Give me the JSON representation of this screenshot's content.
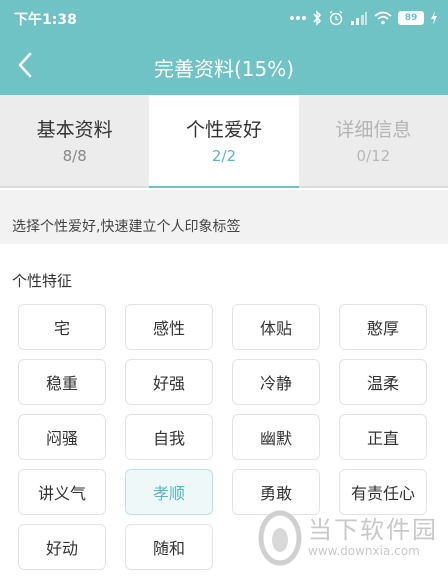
{
  "status_bar": {
    "time": "下午1:38",
    "battery": "89",
    "icons": [
      "dots-icon",
      "bluetooth-icon",
      "alarm-icon",
      "signal-icon",
      "wifi-icon",
      "battery-icon",
      "charging-icon"
    ]
  },
  "nav": {
    "title": "完善资料(15%)",
    "back_icon": "chevron-left-icon"
  },
  "tabs": [
    {
      "label": "基本资料",
      "count": "8/8",
      "state": "done"
    },
    {
      "label": "个性爱好",
      "count": "2/2",
      "state": "active"
    },
    {
      "label": "详细信息",
      "count": "0/12",
      "state": "disabled"
    }
  ],
  "hint": "选择个性爱好,快速建立个人印象标签",
  "section": {
    "title": "个性特征",
    "tags": [
      {
        "label": "宅",
        "selected": false
      },
      {
        "label": "感性",
        "selected": false
      },
      {
        "label": "体贴",
        "selected": false
      },
      {
        "label": "憨厚",
        "selected": false
      },
      {
        "label": "稳重",
        "selected": false
      },
      {
        "label": "好强",
        "selected": false
      },
      {
        "label": "冷静",
        "selected": false
      },
      {
        "label": "温柔",
        "selected": false
      },
      {
        "label": "闷骚",
        "selected": false
      },
      {
        "label": "自我",
        "selected": false
      },
      {
        "label": "幽默",
        "selected": false
      },
      {
        "label": "正直",
        "selected": false
      },
      {
        "label": "讲义气",
        "selected": false
      },
      {
        "label": "孝顺",
        "selected": true
      },
      {
        "label": "勇敢",
        "selected": false
      },
      {
        "label": "有责任心",
        "selected": false
      },
      {
        "label": "好动",
        "selected": false
      },
      {
        "label": "随和",
        "selected": false
      }
    ]
  },
  "watermark": {
    "brand": "当下软件园",
    "url": "www.downxia.com"
  },
  "colors": {
    "accent": "#6fc3c4",
    "selected_text": "#58b8ba",
    "tab_background": "#ececec"
  }
}
